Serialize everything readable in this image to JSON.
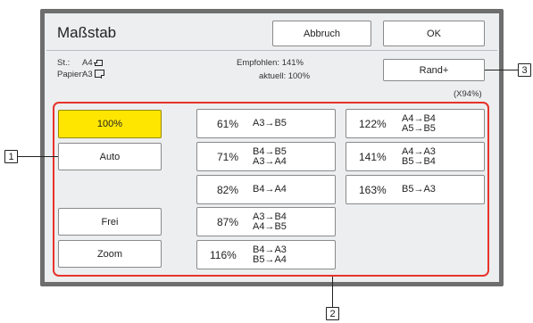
{
  "window": {
    "title": "Maßstab"
  },
  "header": {
    "cancel_label": "Abbruch",
    "ok_label": "OK"
  },
  "info": {
    "st_label": "St.:",
    "st_value": "A4",
    "st_icon": "portrait-paper-icon",
    "paper_label": "Papier:",
    "paper_value": "A3",
    "paper_icon": "landscape-paper-icon",
    "recommended": "Empfohlen: 141%",
    "current": "aktuell: 100%"
  },
  "margin": {
    "button_label": "Rand+",
    "value": "(X94%)"
  },
  "left_buttons": {
    "hundred": "100%",
    "auto": "Auto",
    "free": "Frei",
    "zoom": "Zoom"
  },
  "presets": [
    {
      "pct": "61%",
      "lines": [
        "A3→B5"
      ]
    },
    {
      "pct": "71%",
      "lines": [
        "B4→B5",
        "A3→A4"
      ]
    },
    {
      "pct": "82%",
      "lines": [
        "B4→A4"
      ]
    },
    {
      "pct": "87%",
      "lines": [
        "A3→B4",
        "A4→B5"
      ]
    },
    {
      "pct": "116%",
      "lines": [
        "B4→A3",
        "B5→A4"
      ]
    },
    {
      "pct": "122%",
      "lines": [
        "A4→B4",
        "A5→B5"
      ]
    },
    {
      "pct": "141%",
      "lines": [
        "A4→A3",
        "B5→B4"
      ]
    },
    {
      "pct": "163%",
      "lines": [
        "B5→A3"
      ]
    }
  ],
  "callouts": {
    "c1": "1",
    "c2": "2",
    "c3": "3"
  },
  "colors": {
    "selected": "#ffe600",
    "highlight_frame": "#e8332a",
    "bezel": "#6e6e6e",
    "screen": "#eceeef"
  }
}
